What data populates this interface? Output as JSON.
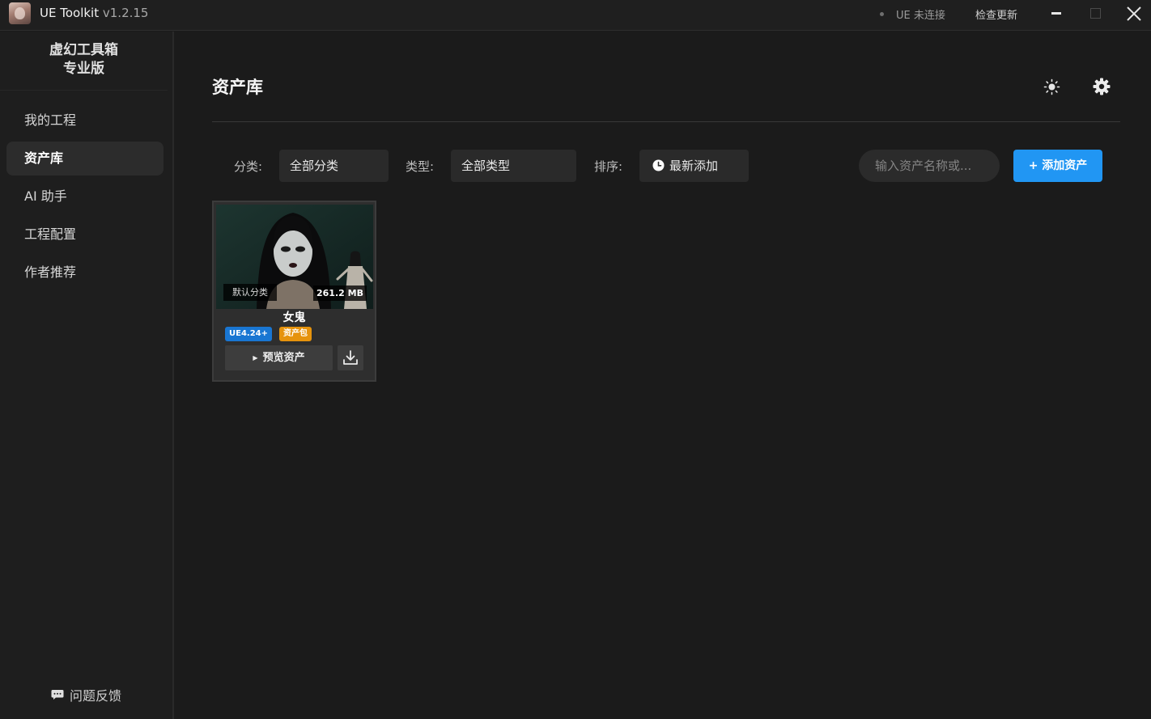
{
  "window": {
    "app_name": "UE Toolkit",
    "version": "v1.2.15",
    "ue_status": "UE 未连接",
    "check_update": "检查更新"
  },
  "sidebar": {
    "brand_line1": "虚幻工具箱",
    "brand_line2": "专业版",
    "items": [
      {
        "label": "我的工程",
        "active": false
      },
      {
        "label": "资产库",
        "active": true
      },
      {
        "label": "AI 助手",
        "active": false
      },
      {
        "label": "工程配置",
        "active": false
      },
      {
        "label": "作者推荐",
        "active": false
      }
    ],
    "feedback": "问题反馈"
  },
  "main": {
    "title": "资产库",
    "filters": {
      "category_label": "分类:",
      "category_value": "全部分类",
      "type_label": "类型:",
      "type_value": "全部类型",
      "sort_label": "排序:",
      "sort_value": "最新添加"
    },
    "search": {
      "placeholder": "输入资产名称或...",
      "value": ""
    },
    "add_button": "+ 添加资产"
  },
  "assets": [
    {
      "category": "默认分类",
      "size": "261.2 MB",
      "name": "女鬼",
      "engine": "UE4.24+",
      "kind": "资产包",
      "preview_label": "预览资产"
    }
  ],
  "colors": {
    "accent": "#2196f3",
    "engine_badge": "#1976d2",
    "kind_badge": "#e6930d",
    "background": "#1b1b1b",
    "sidebar": "#1e1e1e"
  },
  "icons": {
    "theme": "sun-icon",
    "settings": "gear-icon",
    "sort": "clock-icon",
    "feedback": "chat-icon",
    "download": "download-icon",
    "close": "close-icon"
  }
}
